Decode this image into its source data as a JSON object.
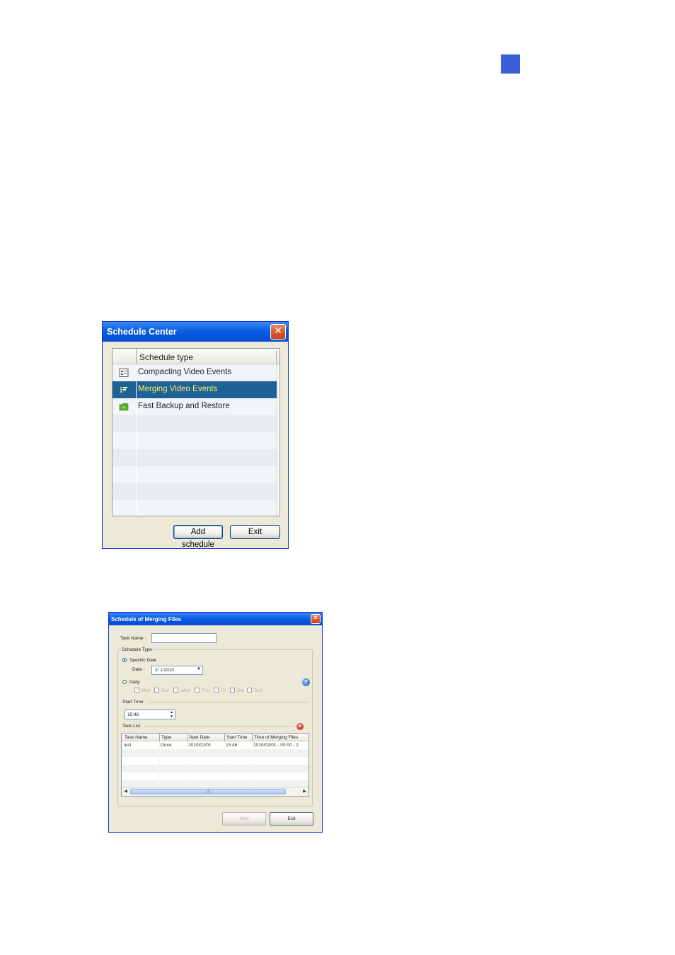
{
  "colors": {
    "page_marker": "#3b5fd8",
    "titlebar": "#0a5fe0",
    "window_bg": "#ece9d8",
    "selected_row": "#1f6296",
    "selected_text": "#f4f06a"
  },
  "schedule_center": {
    "title": "Schedule Center",
    "close_icon": "close-icon",
    "list_header": "Schedule type",
    "items": [
      {
        "label": "Compacting Video Events",
        "icon": "compact-icon",
        "selected": false
      },
      {
        "label": "Merging Video Events",
        "icon": "merge-icon",
        "selected": true
      },
      {
        "label": "Fast Backup and Restore",
        "icon": "folder-icon",
        "selected": false
      }
    ],
    "add_button": "Add schedule",
    "exit_button": "Exit"
  },
  "merging_files": {
    "title": "Schedule of Merging Files",
    "task_name_label": "Task Name :",
    "task_name_value": "",
    "schedule_type_label": "Schedule Type",
    "specific_date_label": "Specific Date",
    "date_label": "Date :",
    "date_value": "2/ 1/2010",
    "daily_label": "Daily",
    "days": [
      "Mon",
      "Tue",
      "Wed",
      "Thu",
      "Fri",
      "Sat",
      "Sun"
    ],
    "start_time_label": "Start Time",
    "start_time_value": "15:46",
    "task_list_label": "Task List",
    "columns": [
      "Task Name",
      "Type",
      "Start Date",
      "Start Time",
      "Time of Merging Files"
    ],
    "rows": [
      {
        "task_name": "test",
        "type": "Once",
        "start_date": "2010/02/01",
        "start_time": "15:46",
        "merge_time": "2010/02/01 - 00:00 - 2"
      }
    ],
    "next_button": "Next",
    "exit_button": "Exit"
  }
}
